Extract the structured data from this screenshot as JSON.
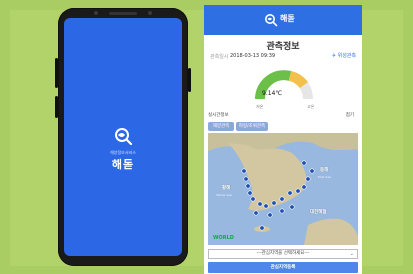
{
  "splash": {
    "brand_small": "해양정보서비스",
    "app_name": "해돋"
  },
  "app": {
    "header_title": "해돋",
    "screen_title": "관측정보",
    "time_label": "관측일시",
    "time_value": "2018-03-13 09:39",
    "location_button": "위성관측",
    "gauge": {
      "temperature": "9.14℃",
      "low_label": "저온",
      "high_label": "고온"
    },
    "section_left": "실시간정보",
    "section_right": "접기",
    "tabs": [
      "해양관측",
      "파랑/조위관측"
    ],
    "map": {
      "labels": {
        "east_sea": "동해",
        "east_sea_en": "East Sea",
        "yellow_sea": "황해",
        "yellow_sea_en": "Yellow Sea",
        "korea_strait": "대한해협"
      },
      "brand": "WORLD"
    },
    "select_placeholder": "---관심지역을 선택하세요---",
    "primary_button": "관심지역등록"
  },
  "colors": {
    "brand_blue": "#2f6fe4",
    "splash_blue": "#2c67e6",
    "background": "#a9cc63"
  }
}
